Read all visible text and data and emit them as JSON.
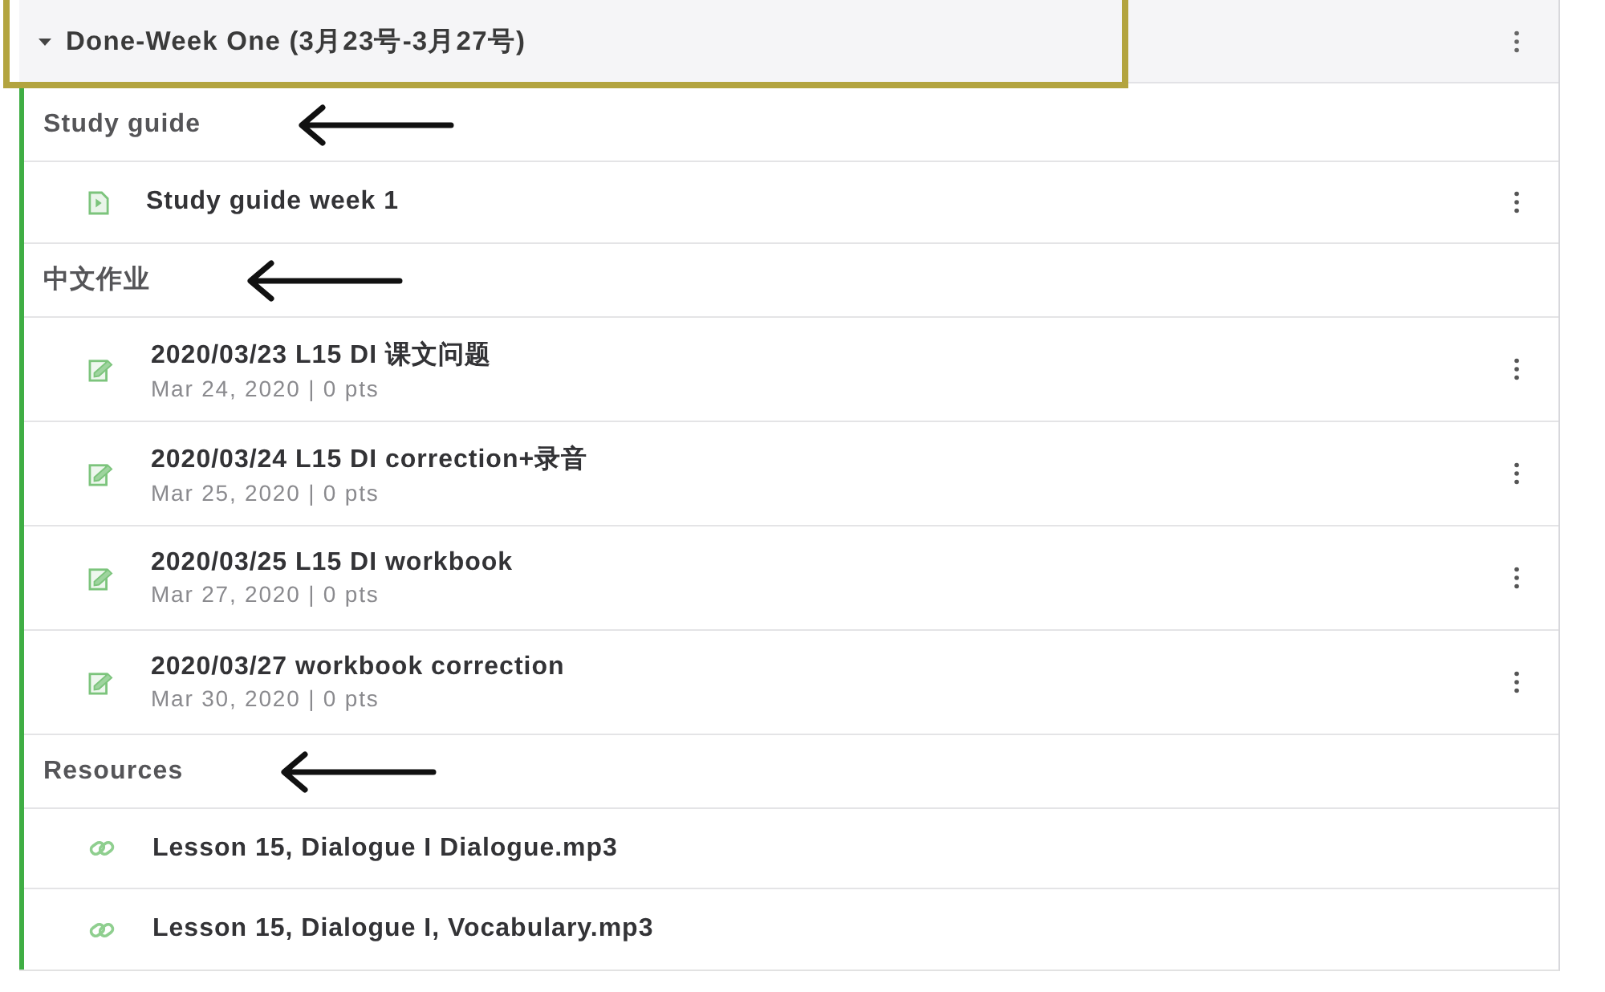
{
  "module": {
    "title": "Done-Week One (3月23号-3月27号)",
    "expanded": true,
    "highlighted": true,
    "menu": true
  },
  "items": [
    {
      "kind": "subheader",
      "title": "Study guide",
      "arrow": true,
      "menu": false
    },
    {
      "kind": "page",
      "title": "Study guide week 1",
      "menu": true
    },
    {
      "kind": "subheader",
      "title": "中文作业",
      "arrow": true,
      "menu": false
    },
    {
      "kind": "assignment",
      "title": "2020/03/23 L15 DI 课文问题",
      "meta": "Mar 24, 2020 | 0 pts",
      "menu": true
    },
    {
      "kind": "assignment",
      "title": "2020/03/24 L15 DI correction+录音",
      "meta": "Mar 25, 2020 | 0 pts",
      "menu": true
    },
    {
      "kind": "assignment",
      "title": "2020/03/25 L15 DI workbook",
      "meta": "Mar 27, 2020 | 0 pts",
      "menu": true
    },
    {
      "kind": "assignment",
      "title": "2020/03/27 workbook correction",
      "meta": "Mar 30, 2020 | 0 pts",
      "menu": true
    },
    {
      "kind": "subheader",
      "title": "Resources",
      "arrow": true,
      "menu": false
    },
    {
      "kind": "link",
      "title": "Lesson 15, Dialogue I Dialogue.mp3",
      "menu": false
    },
    {
      "kind": "link",
      "title": "Lesson 15, Dialogue I, Vocabulary.mp3",
      "menu": false
    }
  ]
}
